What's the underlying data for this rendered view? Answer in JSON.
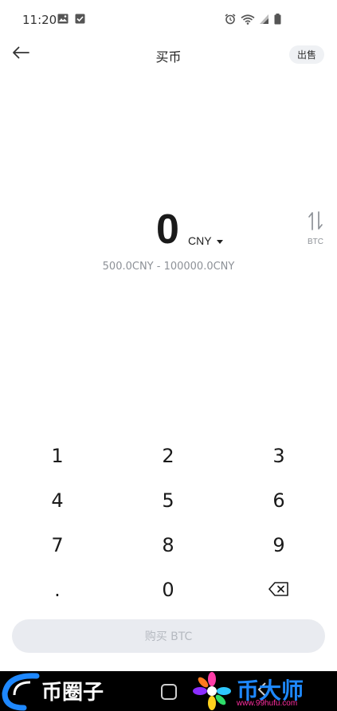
{
  "status_bar": {
    "time": "11:20",
    "left_icons": [
      "image-icon",
      "checkbox-icon"
    ],
    "right_icons": [
      "alarm-icon",
      "wifi-icon",
      "signal-icon",
      "battery-icon"
    ]
  },
  "header": {
    "title": "买币",
    "sell_label": "出售"
  },
  "amount": {
    "value": "0",
    "currency": "CNY",
    "range": "500.0CNY - 100000.0CNY",
    "switch_label": "BTC"
  },
  "keypad": {
    "keys": [
      "1",
      "2",
      "3",
      "4",
      "5",
      "6",
      "7",
      "8",
      "9",
      ".",
      "0"
    ]
  },
  "action": {
    "buy_label": "购买 BTC"
  },
  "watermark": {
    "left_text": "币圈子",
    "right_text": "币大师",
    "right_url": "www.99hufu.com"
  }
}
